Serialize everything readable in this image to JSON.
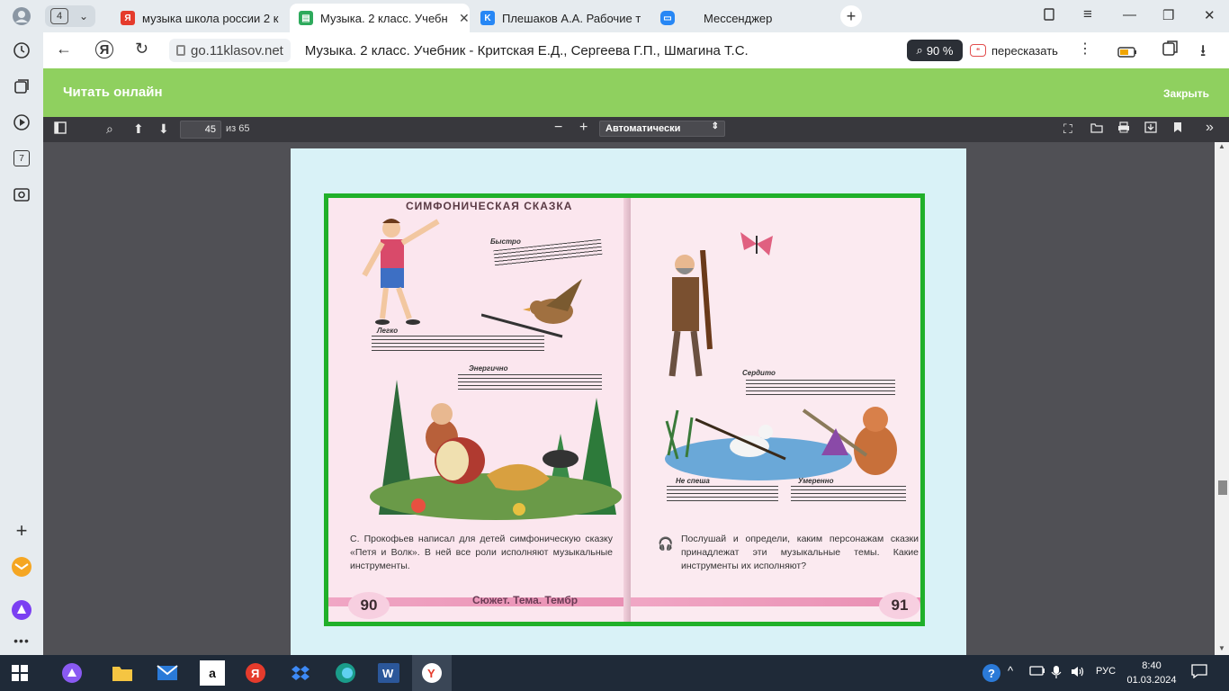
{
  "browser": {
    "tab_count": "4",
    "tabs": [
      {
        "title": "музыка школа россии 2 к",
        "favicon": "yandex-icon",
        "active": false
      },
      {
        "title": "Музыка. 2 класс. Учебн",
        "favicon": "book-icon",
        "active": true
      },
      {
        "title": "Плешаков А.А. Рабочие те",
        "favicon": "vk-icon",
        "active": false
      },
      {
        "title": "Мессенджер",
        "favicon": "messenger-icon",
        "active": false
      }
    ],
    "address": {
      "domain": "go.11klasov.net",
      "page_title": "Музыка. 2 класс. Учебник - Критская Е.Д., Сергеева Г.П., Шмагина Т.С."
    },
    "zoom": "90 %",
    "retell_label": "пересказать",
    "sidebar_badge": "7"
  },
  "site": {
    "header_title": "Читать онлайн",
    "close_label": "Закрыть"
  },
  "pdf_toolbar": {
    "page_number": "45",
    "page_of": "из 65",
    "scale": "Автоматически"
  },
  "book": {
    "left_heading": "СИМФОНИЧЕСКАЯ СКАЗКА",
    "labels": [
      "Быстро",
      "Легко",
      "Энергично",
      "Сердито",
      "Не спеша",
      "Умеренно"
    ],
    "left_text": "С. Прокофьев написал для детей симфоническую сказку «Петя и Волк». В ней все роли исполняют музыкальные инструменты.",
    "right_text": "Послушай и определи, каким персонажам сказки принадлежат эти музыкальные темы. Какие инструменты их исполняют?",
    "footer": "Сюжет. Тема. Тембр",
    "page_left": "90",
    "page_right": "91"
  },
  "taskbar": {
    "lang": "РУС",
    "time": "8:40",
    "date": "01.03.2024"
  },
  "colors": {
    "site_header": "#8fd05f",
    "pdf_toolbar": "#38383d",
    "frame": "#20b02a",
    "page_bg": "#d9f2f7"
  }
}
